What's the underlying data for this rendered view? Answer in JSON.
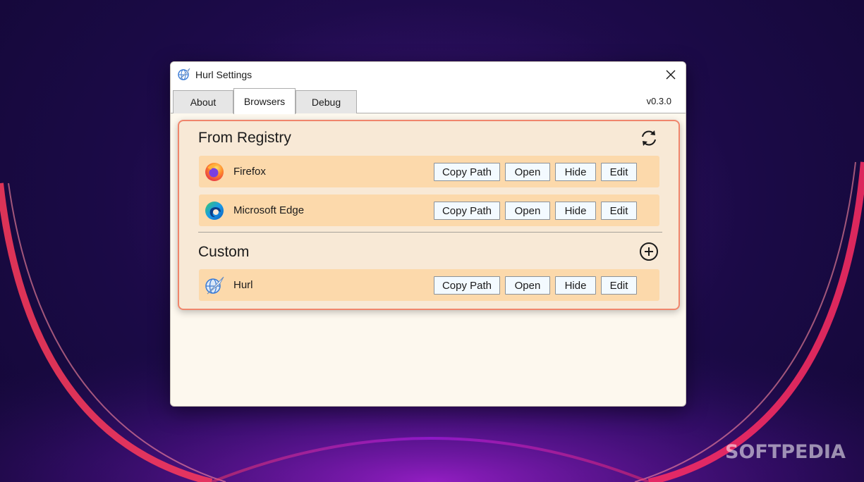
{
  "window": {
    "title": "Hurl Settings",
    "version": "v0.3.0"
  },
  "tabs": [
    {
      "label": "About",
      "active": false
    },
    {
      "label": "Browsers",
      "active": true
    },
    {
      "label": "Debug",
      "active": false
    }
  ],
  "sections": {
    "registry": {
      "title": "From Registry",
      "action_icon": "refresh-icon",
      "browsers": [
        {
          "name": "Firefox",
          "icon": "firefox-icon"
        },
        {
          "name": "Microsoft Edge",
          "icon": "edge-icon"
        }
      ]
    },
    "custom": {
      "title": "Custom",
      "action_icon": "add-circle-icon",
      "browsers": [
        {
          "name": "Hurl",
          "icon": "hurl-icon"
        }
      ]
    }
  },
  "row_buttons": {
    "copy_path": "Copy Path",
    "open": "Open",
    "hide": "Hide",
    "edit": "Edit"
  },
  "watermark": "SOFTPEDIA",
  "colors": {
    "panel_bg": "#f8e9d6",
    "panel_border": "#f0866c",
    "row_bg": "#fcd9ab",
    "button_bg": "#f3faff",
    "window_bg": "#fdf8ee"
  }
}
